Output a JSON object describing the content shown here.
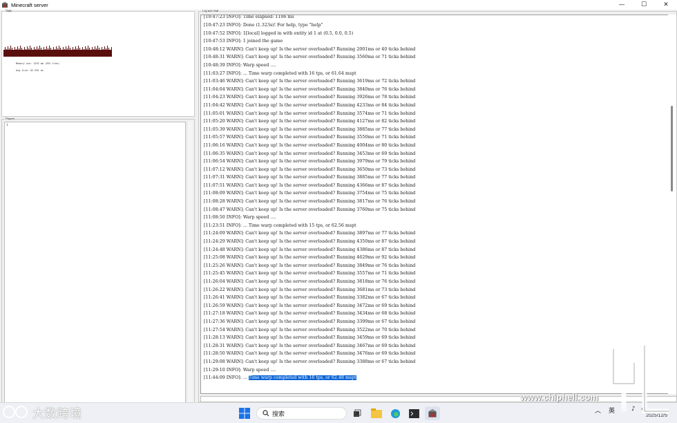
{
  "window": {
    "title": "Minecraft server",
    "controls": {
      "minimize": "—",
      "maximize": "☐",
      "close": "✕"
    }
  },
  "stats": {
    "label": "Stats",
    "memory": "Memory use: 1292 mb (99% free)",
    "tick": "Avg tick: 62.991 ms"
  },
  "players": {
    "label": "Players",
    "items": [
      "1"
    ]
  },
  "log": {
    "label": "Log and chat",
    "lines": [
      "[10:47:23 INFO]: Time elapsed: 1106 ms",
      "[10:47:23 INFO]: Done (1.323s)! For help, type \"help\"",
      "[10:47:52 INFO]: 1[local] logged in with entity id 1 at (0.5, 0.0, 0.5)",
      "[10:47:53 INFO]: 1 joined the game",
      "[10:48:12 WARN]: Can't keep up! Is the server overloaded? Running 2001ms or 40 ticks behind",
      "[10:48:31 WARN]: Can't keep up! Is the server overloaded? Running 3560ms or 71 ticks behind",
      "[10:48:39 INFO]: Warp speed ....",
      "[11:03:27 INFO]: ... Time warp completed with 16 tps, or 61.64 mspt",
      "[11:03:46 WARN]: Can't keep up! Is the server overloaded? Running 3619ms or 72 ticks behind",
      "[11:04:04 WARN]: Can't keep up! Is the server overloaded? Running 3840ms or 76 ticks behind",
      "[11:04:23 WARN]: Can't keep up! Is the server overloaded? Running 3926ms or 78 ticks behind",
      "[11:04:42 WARN]: Can't keep up! Is the server overloaded? Running 4233ms or 84 ticks behind",
      "[11:05:01 WARN]: Can't keep up! Is the server overloaded? Running 3574ms or 71 ticks behind",
      "[11:05:20 WARN]: Can't keep up! Is the server overloaded? Running 4127ms or 82 ticks behind",
      "[11:05:39 WARN]: Can't keep up! Is the server overloaded? Running 3885ms or 77 ticks behind",
      "[11:05:57 WARN]: Can't keep up! Is the server overloaded? Running 3550ms or 71 ticks behind",
      "[11:06:16 WARN]: Can't keep up! Is the server overloaded? Running 4004ms or 80 ticks behind",
      "[11:06:35 WARN]: Can't keep up! Is the server overloaded? Running 3453ms or 69 ticks behind",
      "[11:06:54 WARN]: Can't keep up! Is the server overloaded? Running 3979ms or 79 ticks behind",
      "[11:07:12 WARN]: Can't keep up! Is the server overloaded? Running 3650ms or 73 ticks behind",
      "[11:07:31 WARN]: Can't keep up! Is the server overloaded? Running 3885ms or 77 ticks behind",
      "[11:07:51 WARN]: Can't keep up! Is the server overloaded? Running 4366ms or 87 ticks behind",
      "[11:08:09 WARN]: Can't keep up! Is the server overloaded? Running 3754ms or 75 ticks behind",
      "[11:08:28 WARN]: Can't keep up! Is the server overloaded? Running 3817ms or 76 ticks behind",
      "[11:08:47 WARN]: Can't keep up! Is the server overloaded? Running 3760ms or 75 ticks behind",
      "[11:08:50 INFO]: Warp speed ....",
      "[11:23:51 INFO]: ... Time warp completed with 15 tps, or 62.56 mspt",
      "[11:24:09 WARN]: Can't keep up! Is the server overloaded? Running 3897ms or 77 ticks behind",
      "[11:24:29 WARN]: Can't keep up! Is the server overloaded? Running 4350ms or 87 ticks behind",
      "[11:24:48 WARN]: Can't keep up! Is the server overloaded? Running 4386ms or 87 ticks behind",
      "[11:25:08 WARN]: Can't keep up! Is the server overloaded? Running 4629ms or 92 ticks behind",
      "[11:25:26 WARN]: Can't keep up! Is the server overloaded? Running 3849ms or 76 ticks behind",
      "[11:25:45 WARN]: Can't keep up! Is the server overloaded? Running 3557ms or 71 ticks behind",
      "[11:26:04 WARN]: Can't keep up! Is the server overloaded? Running 3818ms or 76 ticks behind",
      "[11:26:22 WARN]: Can't keep up! Is the server overloaded? Running 3681ms or 73 ticks behind",
      "[11:26:41 WARN]: Can't keep up! Is the server overloaded? Running 3382ms or 67 ticks behind",
      "[11:26:59 WARN]: Can't keep up! Is the server overloaded? Running 3472ms or 69 ticks behind",
      "[11:27:18 WARN]: Can't keep up! Is the server overloaded? Running 3434ms or 68 ticks behind",
      "[11:27:36 WARN]: Can't keep up! Is the server overloaded? Running 3399ms or 67 ticks behind",
      "[11:27:54 WARN]: Can't keep up! Is the server overloaded? Running 3522ms or 70 ticks behind",
      "[11:28:13 WARN]: Can't keep up! Is the server overloaded? Running 3459ms or 69 ticks behind",
      "[11:28:31 WARN]: Can't keep up! Is the server overloaded? Running 3467ms or 69 ticks behind",
      "[11:28:50 WARN]: Can't keep up! Is the server overloaded? Running 3476ms or 69 ticks behind",
      "[11:29:08 WARN]: Can't keep up! Is the server overloaded? Running 3388ms or 67 ticks behind",
      "[11:29:10 INFO]: Warp speed ...."
    ],
    "last_prefix": "[11:44:09 INFO]: ... ",
    "last_selected": "Time warp completed with 16 tps, or 62.48 mspt"
  },
  "taskbar": {
    "search_label": "搜索",
    "input_method": "英",
    "date": "2025/12/5",
    "icons": [
      "windows-start-icon",
      "search-icon",
      "task-view-icon",
      "file-explorer-icon",
      "edge-browser-icon",
      "terminal-icon",
      "minecraft-server-icon"
    ]
  },
  "watermarks": {
    "left": "大数跨境",
    "right_url": "www.chiphell.com"
  },
  "colors": {
    "selection": "#0a64d6",
    "graph_bar": "#5a0f0f"
  }
}
